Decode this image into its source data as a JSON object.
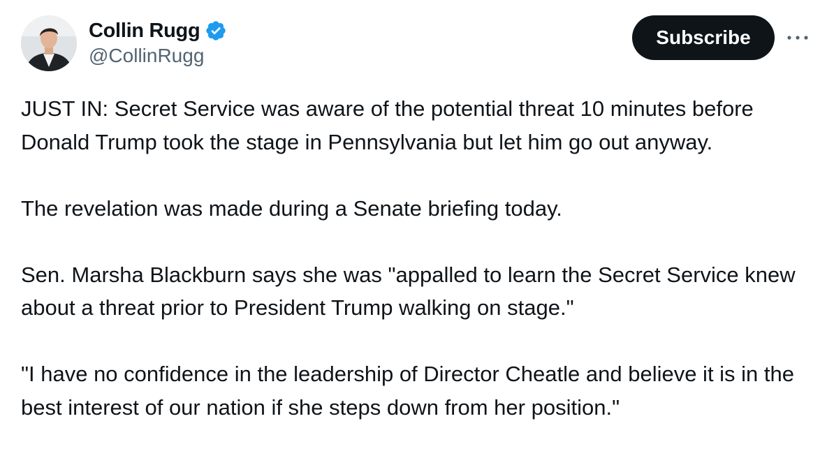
{
  "author": {
    "name": "Collin Rugg",
    "handle": "@CollinRugg",
    "verified_icon": "verified-badge-icon",
    "verified_color": "#1d9bf0"
  },
  "actions": {
    "subscribe_label": "Subscribe",
    "more_icon": "more-options-icon"
  },
  "tweet": {
    "paragraphs": [
      "JUST IN: Secret Service was aware of the potential threat 10 minutes before Donald Trump took the stage in Pennsylvania but let him go out anyway.",
      "The revelation was made during a Senate briefing today.",
      "Sen. Marsha Blackburn says she was \"appalled to learn the Secret Service knew about a threat prior to President Trump walking on stage.\"",
      "\"I have no confidence in the leadership of Director Cheatle and believe it is in the best interest of our nation if she steps down from her position.\""
    ]
  },
  "colors": {
    "text": "#0f1419",
    "secondary_text": "#536471",
    "button_bg": "#0f1419",
    "button_text": "#ffffff"
  }
}
